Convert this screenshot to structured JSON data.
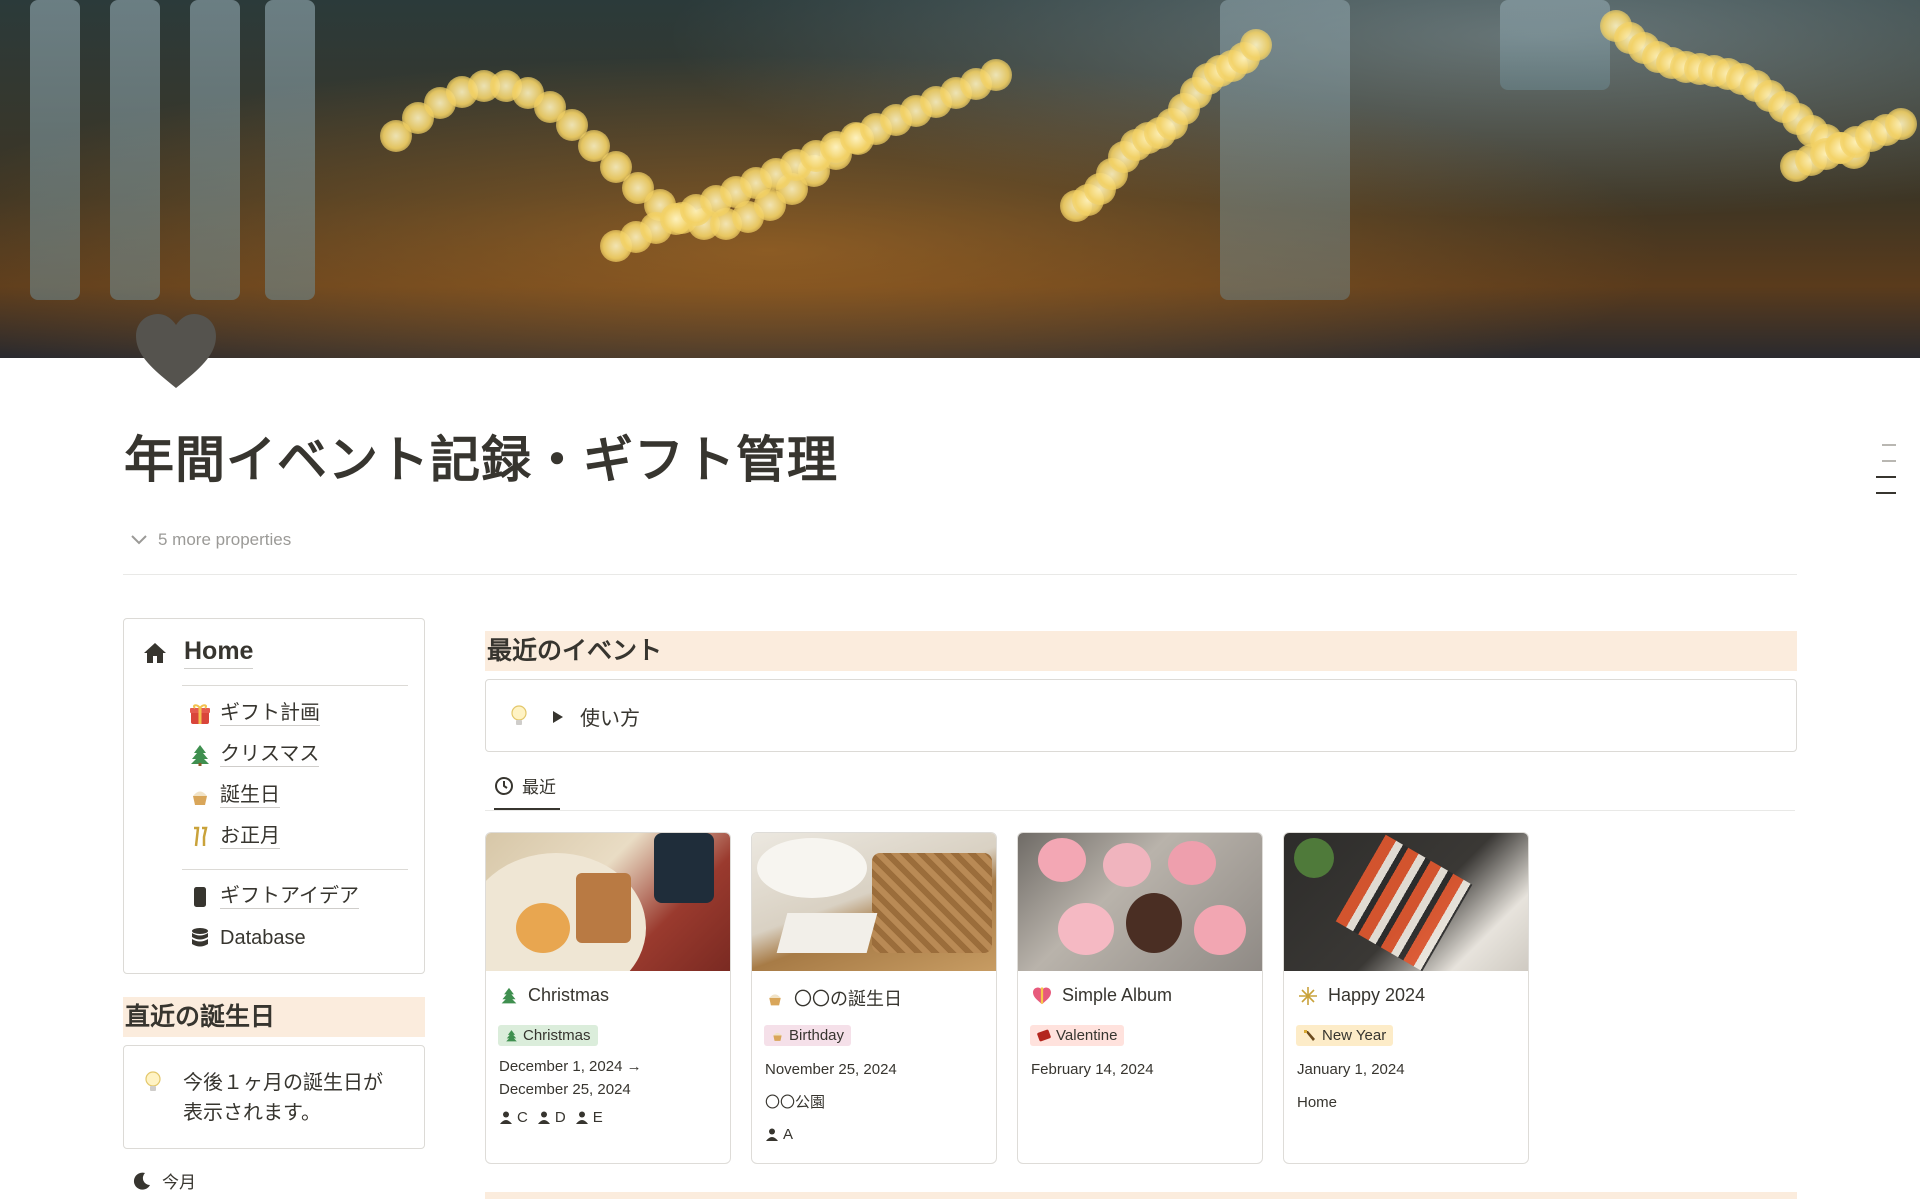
{
  "page": {
    "title": "年間イベント記録・ギフト管理",
    "icon": "heart-icon",
    "more_properties": "5 more properties"
  },
  "sidebar": {
    "home_label": "Home",
    "items": [
      {
        "icon": "gift-icon",
        "label": "ギフト計画"
      },
      {
        "icon": "christmas-tree-icon",
        "label": "クリスマス"
      },
      {
        "icon": "cupcake-icon",
        "label": "誕生日"
      },
      {
        "icon": "champagne-icon",
        "label": "お正月"
      }
    ],
    "items2": [
      {
        "icon": "phone-icon",
        "label": "ギフトアイデア"
      },
      {
        "icon": "database-icon",
        "label": "Database"
      }
    ]
  },
  "birthdays": {
    "heading": "直近の誕生日",
    "callout_line1": "今後１ヶ月の誕生日が",
    "callout_line2": "表示されます。",
    "view_label": "今月"
  },
  "events": {
    "heading": "最近のイベント",
    "toggle_label": "使い方",
    "view_label": "最近",
    "cards": [
      {
        "title": "Christmas",
        "tag": "Christmas",
        "tag_color": "#dbeddb",
        "date_line1": "December 1, 2024 →",
        "date_line2": "December 25, 2024",
        "people": [
          "C",
          "D",
          "E"
        ]
      },
      {
        "title": "〇〇の誕生日",
        "tag": "Birthday",
        "tag_color": "#f5e0e9",
        "date": "November 25, 2024",
        "place": "〇〇公園",
        "people": [
          "A"
        ]
      },
      {
        "title": "Simple Album",
        "tag": "Valentine",
        "tag_color": "#ffe2dd",
        "date": "February 14, 2024"
      },
      {
        "title": "Happy 2024",
        "tag": "New Year",
        "tag_color": "#fdecc8",
        "date": "January 1, 2024",
        "place": "Home"
      }
    ]
  },
  "colors": {
    "section_bg": "#fbecdd",
    "text": "#37352f",
    "muted": "#9b9a97"
  }
}
